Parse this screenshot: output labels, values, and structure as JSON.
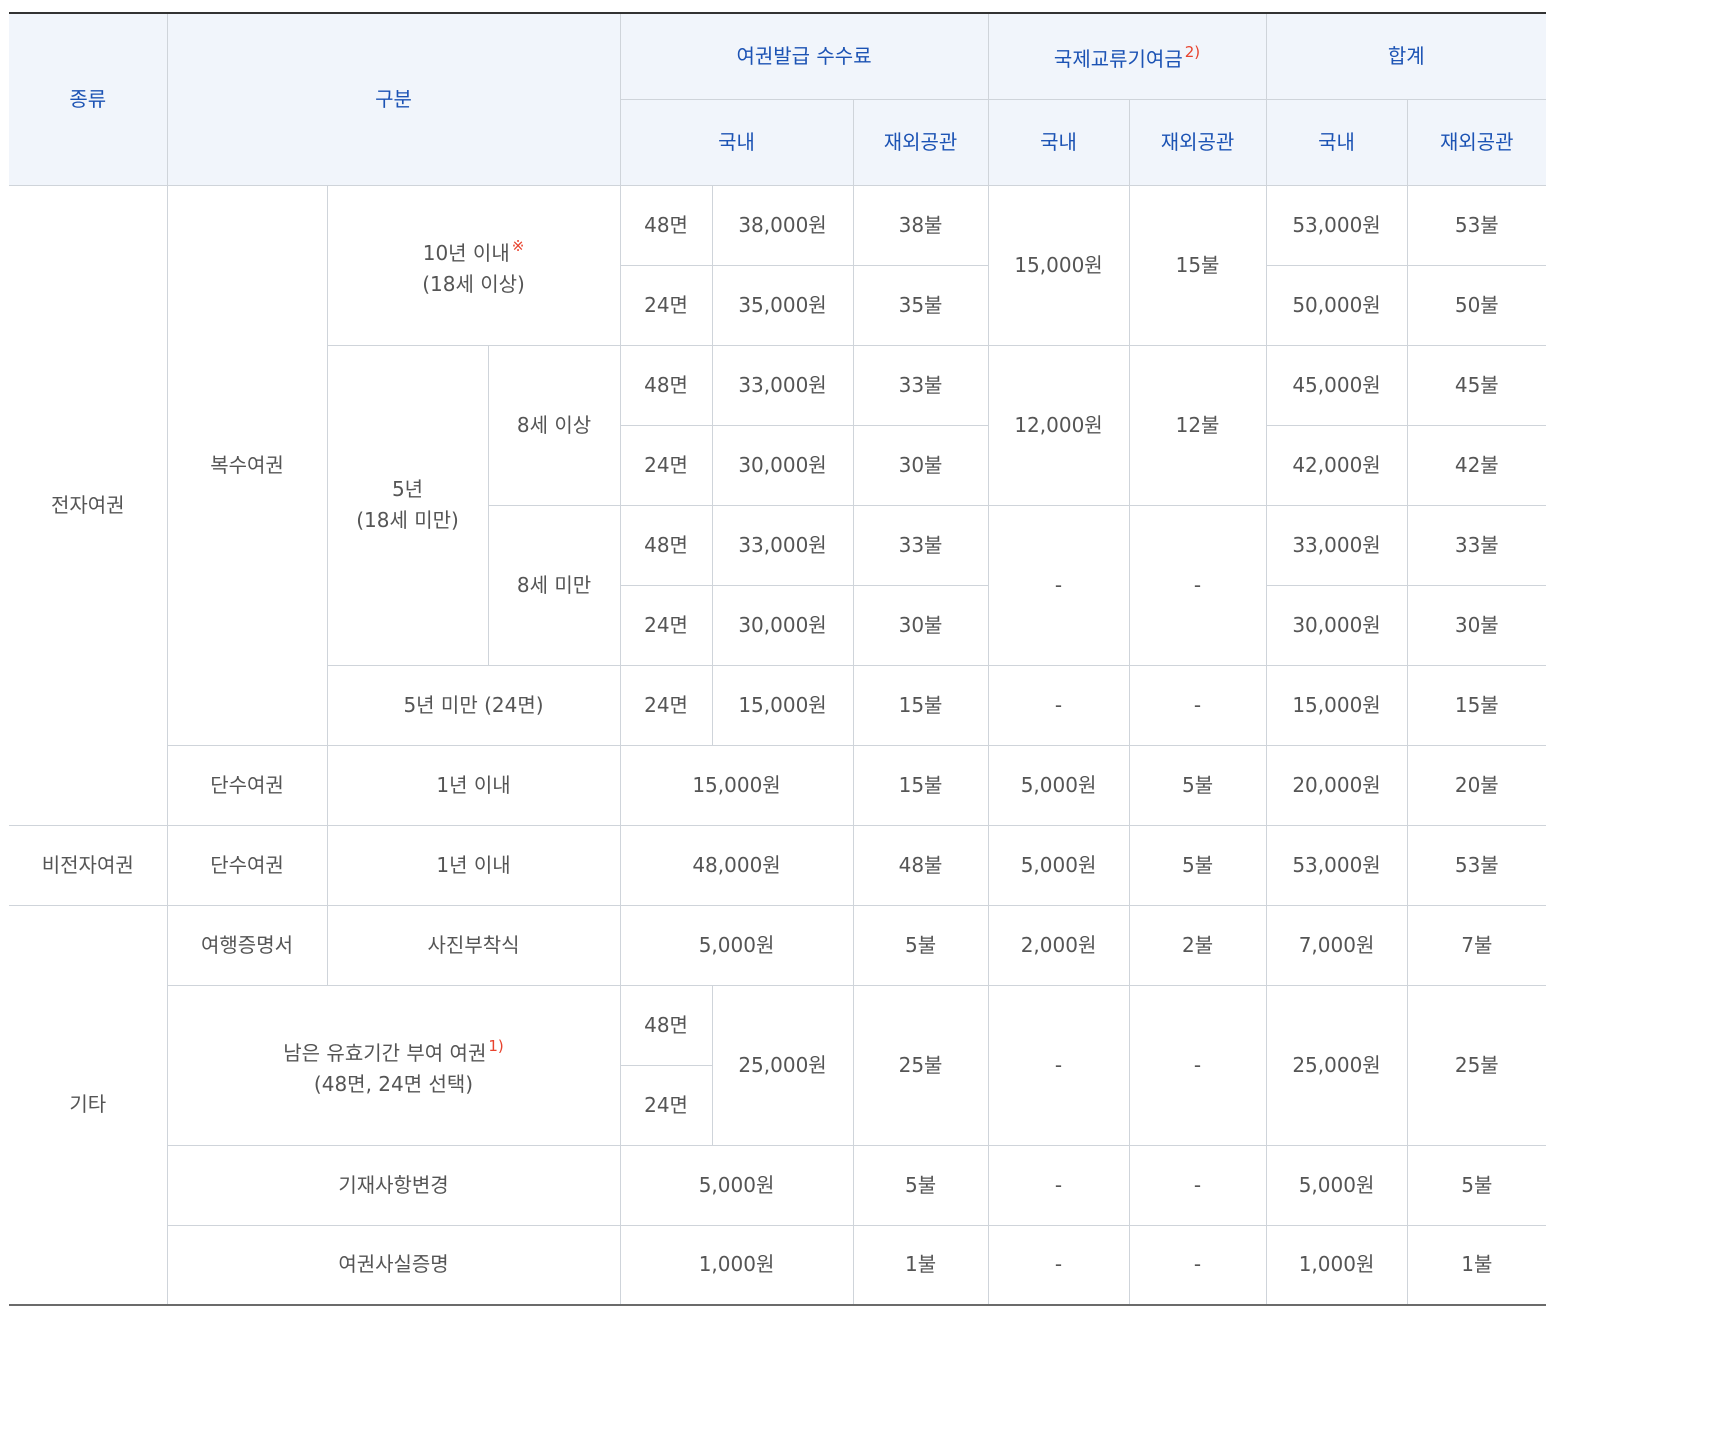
{
  "colors": {
    "header_bg": "#f1f5fb",
    "header_text": "#1c53b4",
    "body_text": "#555555",
    "border": "#cfd4da",
    "note_mark": "#e8432e"
  },
  "header": {
    "type": "종류",
    "category": "구분",
    "issue_fee": "여권발급 수수료",
    "intl_fund": "국제교류기여금",
    "intl_fund_note": "2)",
    "total": "합계",
    "domestic": "국내",
    "overseas": "재외공관"
  },
  "rows": {
    "epassport": "전자여권",
    "multiple": "복수여권",
    "ten_year_line1": "10년 이내",
    "ten_year_mark": "※",
    "ten_year_line2": "(18세 이상)",
    "five_year_line1": "5년",
    "five_year_line2": "(18세 미만)",
    "age8_over": "8세 이상",
    "age8_under": "8세 미만",
    "under_five": "5년 미만 (24면)",
    "single": "단수여권",
    "one_year": "1년 이내",
    "non_epassport": "비전자여권",
    "other": "기타",
    "travel_cert": "여행증명서",
    "photo_attached": "사진부착식",
    "remaining_line1": "남은 유효기간 부여 여권",
    "remaining_note": "1)",
    "remaining_line2": "(48면, 24면 선택)",
    "change_entry": "기재사항변경",
    "passport_fact": "여권사실증명"
  },
  "pages": {
    "p48": "48면",
    "p24": "24면"
  },
  "dash": "-",
  "values": {
    "e10_48": {
      "fee_dom": "38,000원",
      "fee_ovs": "38불",
      "tot_dom": "53,000원",
      "tot_ovs": "53불"
    },
    "e10_24": {
      "fee_dom": "35,000원",
      "fee_ovs": "35불",
      "tot_dom": "50,000원",
      "tot_ovs": "50불"
    },
    "e10_fund": {
      "dom": "15,000원",
      "ovs": "15불"
    },
    "e5o_48": {
      "fee_dom": "33,000원",
      "fee_ovs": "33불",
      "tot_dom": "45,000원",
      "tot_ovs": "45불"
    },
    "e5o_24": {
      "fee_dom": "30,000원",
      "fee_ovs": "30불",
      "tot_dom": "42,000원",
      "tot_ovs": "42불"
    },
    "e5o_fund": {
      "dom": "12,000원",
      "ovs": "12불"
    },
    "e5u_48": {
      "fee_dom": "33,000원",
      "fee_ovs": "33불",
      "tot_dom": "33,000원",
      "tot_ovs": "33불"
    },
    "e5u_24": {
      "fee_dom": "30,000원",
      "fee_ovs": "30불",
      "tot_dom": "30,000원",
      "tot_ovs": "30불"
    },
    "eu5": {
      "fee_dom": "15,000원",
      "fee_ovs": "15불",
      "tot_dom": "15,000원",
      "tot_ovs": "15불"
    },
    "esingle": {
      "fee_dom": "15,000원",
      "fee_ovs": "15불",
      "fund_dom": "5,000원",
      "fund_ovs": "5불",
      "tot_dom": "20,000원",
      "tot_ovs": "20불"
    },
    "nsingle": {
      "fee_dom": "48,000원",
      "fee_ovs": "48불",
      "fund_dom": "5,000원",
      "fund_ovs": "5불",
      "tot_dom": "53,000원",
      "tot_ovs": "53불"
    },
    "travel": {
      "fee_dom": "5,000원",
      "fee_ovs": "5불",
      "fund_dom": "2,000원",
      "fund_ovs": "2불",
      "tot_dom": "7,000원",
      "tot_ovs": "7불"
    },
    "remaining": {
      "fee_dom": "25,000원",
      "fee_ovs": "25불",
      "tot_dom": "25,000원",
      "tot_ovs": "25불"
    },
    "change": {
      "fee_dom": "5,000원",
      "fee_ovs": "5불",
      "tot_dom": "5,000원",
      "tot_ovs": "5불"
    },
    "fact": {
      "fee_dom": "1,000원",
      "fee_ovs": "1불",
      "tot_dom": "1,000원",
      "tot_ovs": "1불"
    }
  }
}
